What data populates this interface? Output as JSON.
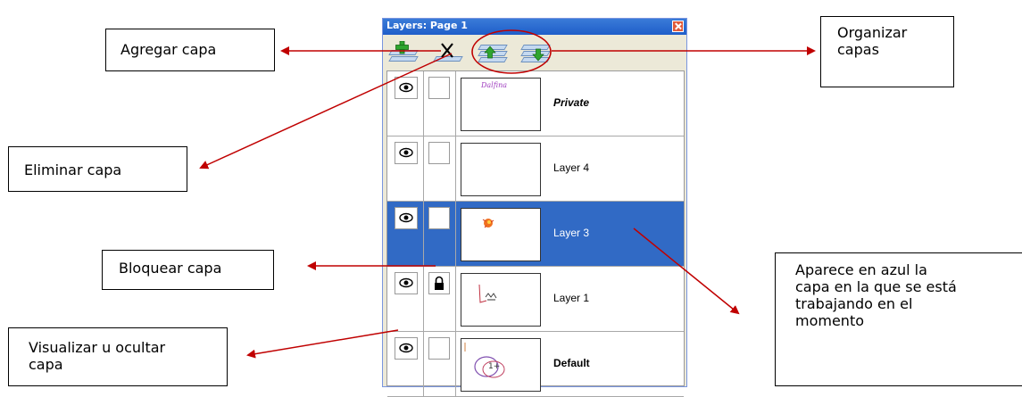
{
  "panel": {
    "title": "Layers: Page 1",
    "toolbar": [
      {
        "icon": "add-layer-icon"
      },
      {
        "icon": "delete-layer-icon"
      },
      {
        "icon": "move-layer-up-icon"
      },
      {
        "icon": "move-layer-down-icon"
      }
    ],
    "layers": [
      {
        "name": "Private",
        "visible": true,
        "locked": false,
        "selected": false,
        "thumb_text": "Dalfina"
      },
      {
        "name": "Layer 4",
        "visible": true,
        "locked": false,
        "selected": false,
        "thumb_text": ""
      },
      {
        "name": "Layer 3",
        "visible": true,
        "locked": false,
        "selected": true,
        "thumb_text": ""
      },
      {
        "name": "Layer 1",
        "visible": true,
        "locked": true,
        "selected": false,
        "thumb_text": ""
      },
      {
        "name": "Default",
        "visible": true,
        "locked": false,
        "selected": false,
        "thumb_text": "1+"
      }
    ]
  },
  "callouts": {
    "add": "Agregar capa",
    "organize": "Organizar\ncapas",
    "delete": "Eliminar capa",
    "lock": "Bloquear capa",
    "selected_note": "Aparece en azul la\ncapa en la que se está\ntrabajando en el\nmomento",
    "visibility": "Visualizar u ocultar\ncapa"
  },
  "colors": {
    "arrow": "#c00000",
    "selection": "#316ac5",
    "titlebar": "#2a6bd2"
  }
}
